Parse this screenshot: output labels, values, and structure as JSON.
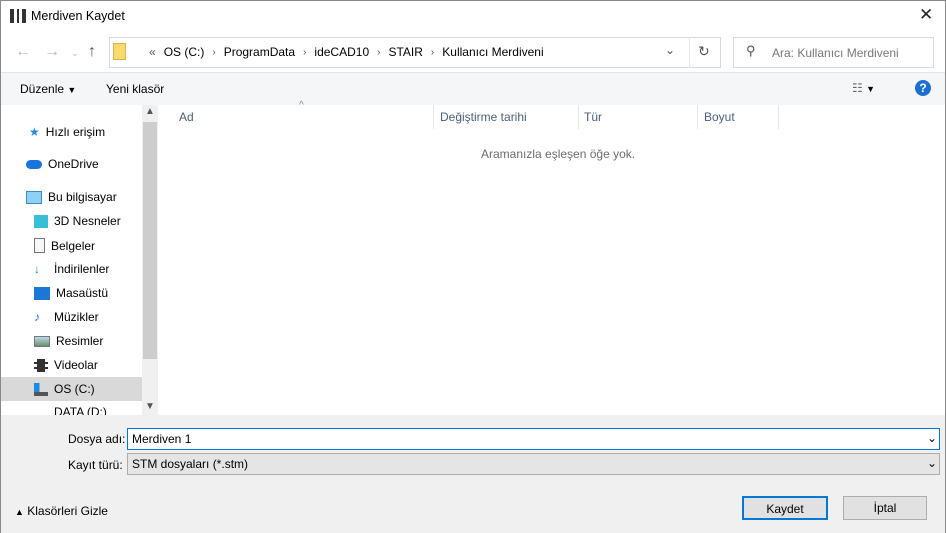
{
  "window": {
    "title": "Merdiven Kaydet"
  },
  "address": {
    "overflow": "«",
    "crumbs": [
      "OS (C:)",
      "ProgramData",
      "ideCAD10",
      "STAIR",
      "Kullanıcı Merdiveni"
    ]
  },
  "search": {
    "placeholder": "Ara: Kullanıcı Merdiveni"
  },
  "toolbar": {
    "organize": "Düzenle",
    "new_folder": "Yeni klasör"
  },
  "sidebar": {
    "items": [
      {
        "label": "Hızlı erişim",
        "icon": "star-icon"
      },
      {
        "label": "OneDrive",
        "icon": "cloud-icon"
      },
      {
        "label": "Bu bilgisayar",
        "icon": "computer-icon"
      },
      {
        "label": "3D Nesneler",
        "icon": "cube-icon"
      },
      {
        "label": "Belgeler",
        "icon": "document-icon"
      },
      {
        "label": "İndirilenler",
        "icon": "download-icon"
      },
      {
        "label": "Masaüstü",
        "icon": "desktop-icon"
      },
      {
        "label": "Müzikler",
        "icon": "music-icon"
      },
      {
        "label": "Resimler",
        "icon": "picture-icon"
      },
      {
        "label": "Videolar",
        "icon": "video-icon"
      },
      {
        "label": "OS (C:)",
        "icon": "drive-icon"
      },
      {
        "label": "DATA (D:)",
        "icon": "drive-icon"
      }
    ]
  },
  "columns": [
    "Ad",
    "Değiştirme tarihi",
    "Tür",
    "Boyut"
  ],
  "empty_message": "Aramanızla eşleşen öğe yok.",
  "form": {
    "filename_label": "Dosya adı:",
    "filename_value": "Merdiven 1",
    "type_label": "Kayıt türü:",
    "type_value": "STM dosyaları (*.stm)"
  },
  "footer": {
    "hide_folders": "Klasörleri Gizle",
    "save": "Kaydet",
    "cancel": "İptal"
  }
}
